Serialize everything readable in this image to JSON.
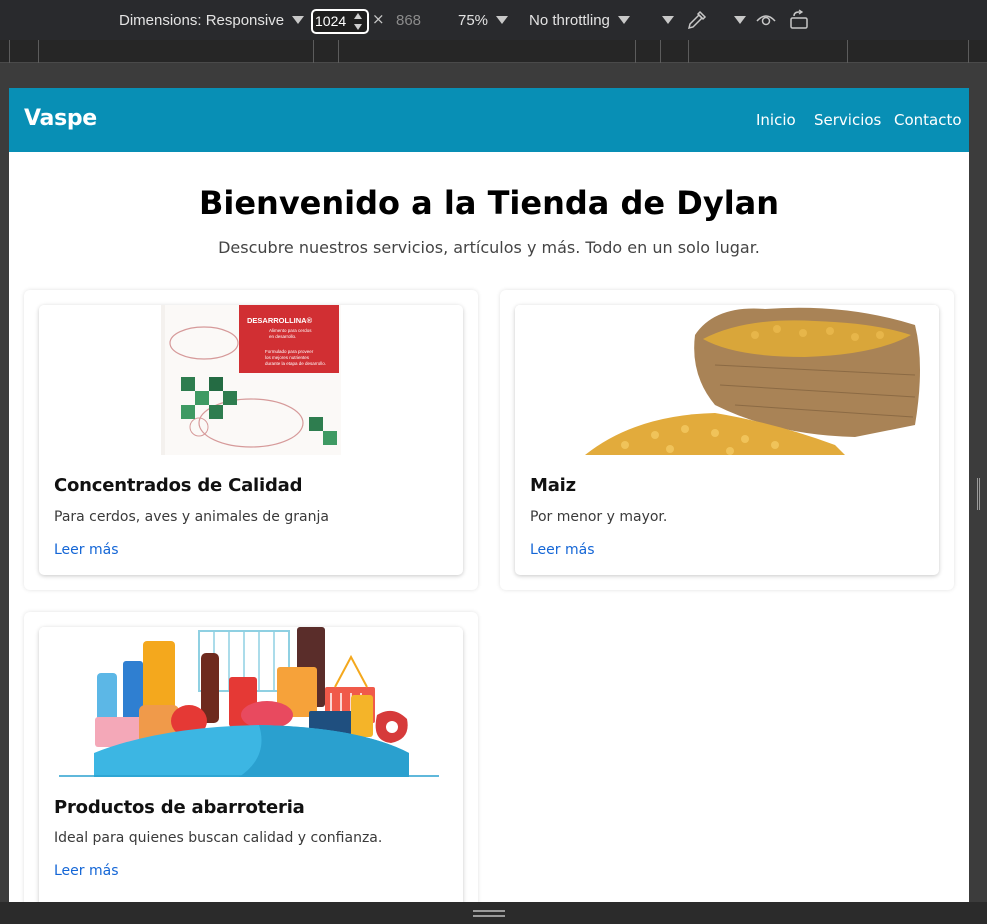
{
  "devtools": {
    "dimensions_label": "Dimensions: Responsive",
    "width_value": "1024",
    "times": "×",
    "height_value": "868",
    "zoom_label": "75%",
    "throttling_label": "No throttling"
  },
  "site": {
    "brand": "Vaspe",
    "nav": [
      "Inicio",
      "Servicios",
      "Contacto"
    ],
    "hero": {
      "title": "Bienvenido a la Tienda de Dylan",
      "subtitle": "Descubre nuestros servicios, artículos y más. Todo en un solo lugar."
    },
    "cards": [
      {
        "title": "Concentrados de Calidad",
        "text": "Para cerdos, aves y animales de granja",
        "link": "Leer más",
        "image_text": [
          "DESARROLLINA®",
          "Alimento para cerdos",
          "en desarrollo.",
          "Formulado para proveer",
          "los mejores nutrientes",
          "durante la etapa de desarrollo."
        ]
      },
      {
        "title": "Maiz",
        "text": "Por menor y mayor.",
        "link": "Leer más"
      },
      {
        "title": "Productos de abarroteria",
        "text": "Ideal para quienes buscan calidad y confianza.",
        "link": "Leer más"
      }
    ]
  },
  "colors": {
    "navbar": "#088fb5",
    "link": "#1466d6",
    "devtools_bg": "#292a2d"
  },
  "icons": [
    "chevron-down-icon",
    "eyedropper-icon",
    "eye-icon",
    "rotate-icon",
    "resize-grip-icon"
  ]
}
